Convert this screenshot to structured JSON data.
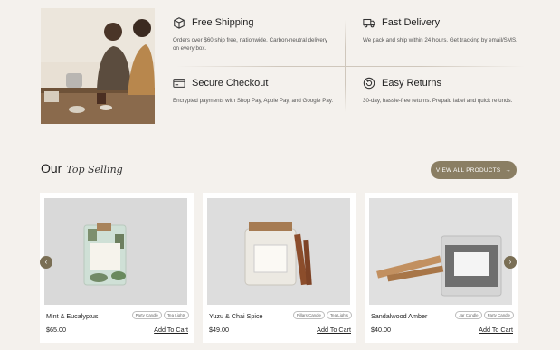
{
  "features": [
    {
      "title": "Free Shipping",
      "desc": "Orders over $60 ship free, nationwide. Carbon-neutral delivery on every box.",
      "icon": "box-icon"
    },
    {
      "title": "Fast Delivery",
      "desc": "We pack and ship within 24 hours. Get tracking by email/SMS.",
      "icon": "truck-icon"
    },
    {
      "title": "Secure Checkout",
      "desc": "Encrypted payments with Shop Pay, Apple Pay, and Google Pay.",
      "icon": "credit-card-icon"
    },
    {
      "title": "Easy Returns",
      "desc": "30-day, hassle-free returns. Prepaid label and quick refunds.",
      "icon": "returns-icon"
    }
  ],
  "section": {
    "title_plain": "Our",
    "title_script": "Top Selling"
  },
  "view_all": {
    "label": "VIEW ALL PRODUCTS",
    "icon": "arrow-right-icon"
  },
  "products": [
    {
      "name": "Mint & Eucalyptus",
      "price": "$65.00",
      "tags": [
        "Party Candle",
        "Tea Lights"
      ],
      "add": "Add To Cart",
      "jar_label": "GREEN MINT & EUCALYPTUS"
    },
    {
      "name": "Yuzu & Chai Spice",
      "price": "$49.00",
      "tags": [
        "Pillars Candle",
        "Tea Lights"
      ],
      "add": "Add To Cart",
      "jar_label": "VANILLA CHAI SPICE"
    },
    {
      "name": "Sandalwood Amber",
      "price": "$40.00",
      "tags": [
        "Jar Candle",
        "Party Candle"
      ],
      "add": "Add To Cart",
      "jar_label": "SANDALWOOD AMBER"
    }
  ],
  "carousel": {
    "prev_icon": "chevron-left-icon",
    "next_icon": "chevron-right-icon"
  },
  "colors": {
    "background": "#f4f1ed",
    "accent": "#8a7e63",
    "card": "#ffffff"
  }
}
